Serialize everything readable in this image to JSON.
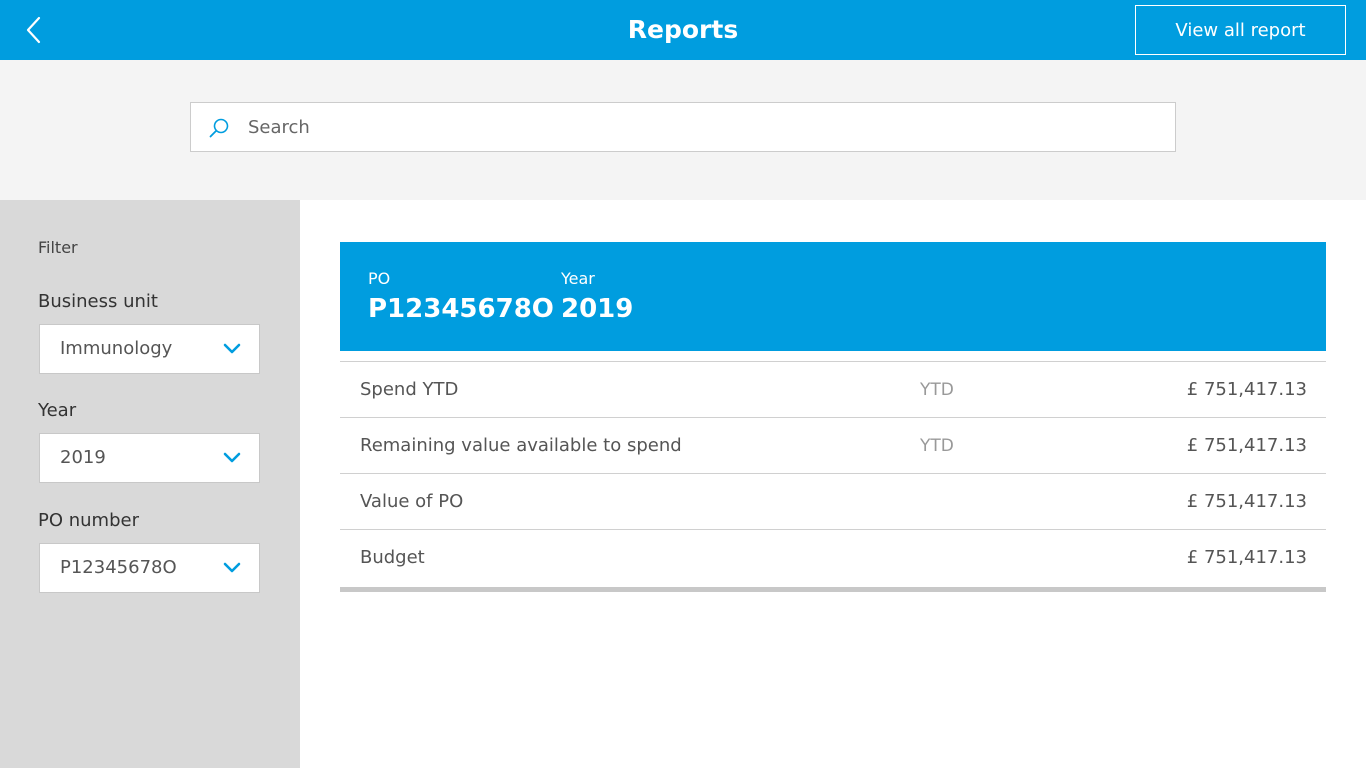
{
  "header": {
    "title": "Reports",
    "view_all_label": "View all report"
  },
  "search": {
    "placeholder": "Search",
    "value": ""
  },
  "sidebar": {
    "heading": "Filter",
    "business_unit": {
      "label": "Business unit",
      "value": "Immunology"
    },
    "year": {
      "label": "Year",
      "value": "2019"
    },
    "po_number": {
      "label": "PO number",
      "value": "P12345678O"
    }
  },
  "po_banner": {
    "po_label": "PO",
    "po_value": "P12345678O",
    "year_label": "Year",
    "year_value": "2019"
  },
  "report_rows": [
    {
      "label": "Spend YTD",
      "period": "YTD",
      "amount": "£ 751,417.13"
    },
    {
      "label": "Remaining value available to spend",
      "period": "YTD",
      "amount": "£ 751,417.13"
    },
    {
      "label": "Value of PO",
      "period": "",
      "amount": "£ 751,417.13"
    },
    {
      "label": "Budget",
      "period": "",
      "amount": "£ 751,417.13"
    }
  ],
  "colors": {
    "brand_blue": "#009ddf",
    "sidebar_grey": "#d9d9d9",
    "search_band": "#f4f4f4"
  },
  "icons": {
    "back": "chevron-left-icon",
    "search": "search-icon",
    "dropdown": "chevron-down-icon"
  }
}
